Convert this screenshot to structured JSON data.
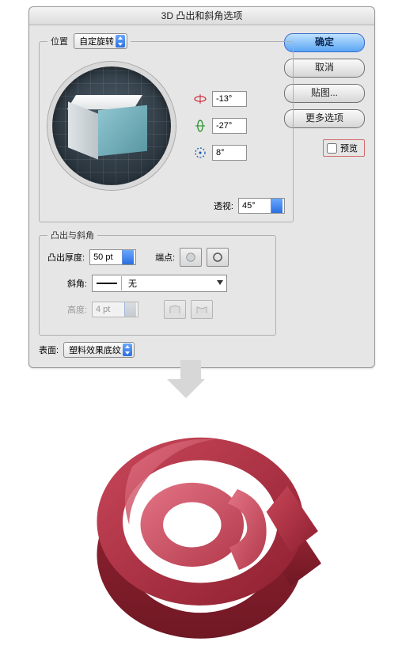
{
  "dialog": {
    "title": "3D 凸出和斜角选项",
    "position": {
      "legend": "位置",
      "preset": "自定旋转",
      "rotX": "-13°",
      "rotY": "-27°",
      "rotZ": "8°",
      "perspectiveLabel": "透视:",
      "perspective": "45°"
    },
    "extrude": {
      "legend": "凸出与斜角",
      "depthLabel": "凸出厚度:",
      "depth": "50 pt",
      "capLabel": "端点:",
      "bevelLabel": "斜角:",
      "bevelPreset": "无",
      "heightLabel": "高度:",
      "height": "4 pt"
    },
    "surface": {
      "label": "表面:",
      "value": "塑料效果底纹"
    },
    "buttons": {
      "ok": "确定",
      "cancel": "取消",
      "mapArt": "贴图...",
      "moreOptions": "更多选项"
    },
    "previewLabel": "预览"
  }
}
